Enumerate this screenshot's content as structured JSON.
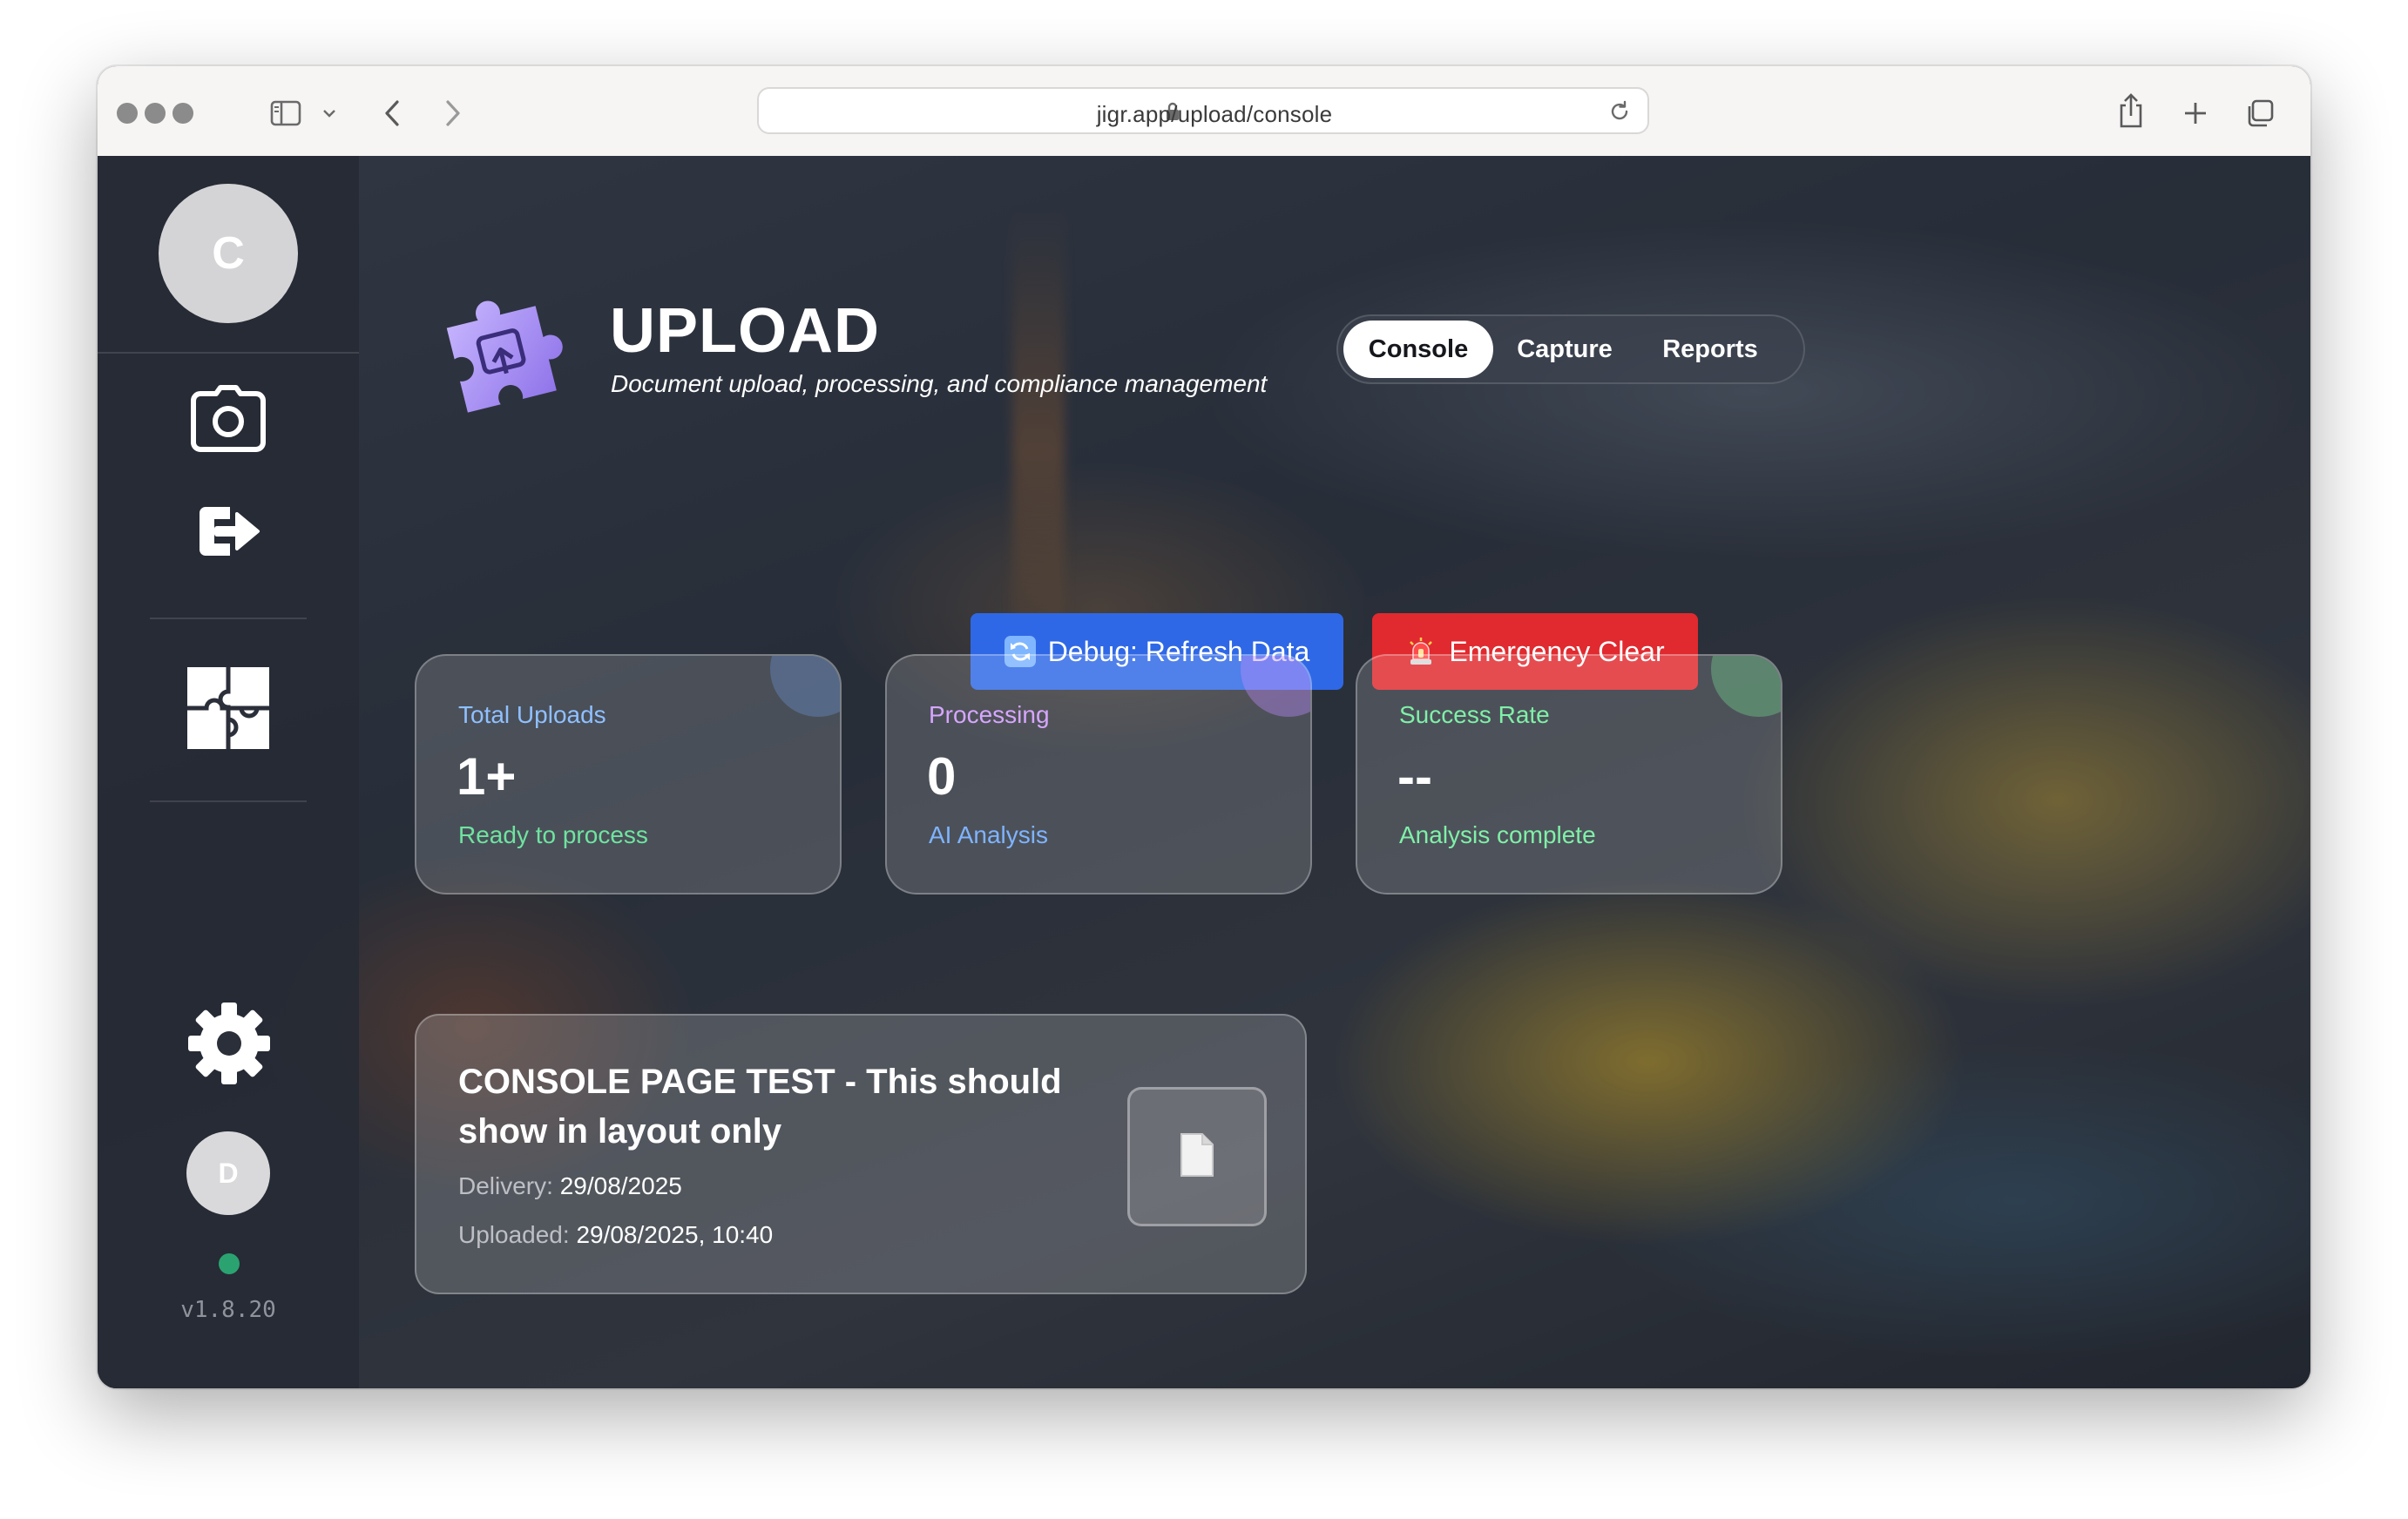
{
  "browser": {
    "url": "jigr.app/upload/console"
  },
  "sidebar": {
    "avatar_top": "C",
    "avatar_bottom": "D",
    "version": "v1.8.20",
    "icons": [
      "camera-icon",
      "logout-icon",
      "puzzle-icon",
      "gear-icon"
    ]
  },
  "header": {
    "title": "UPLOAD",
    "subtitle": "Document upload, processing, and compliance management"
  },
  "tabs": [
    {
      "label": "Console",
      "active": true
    },
    {
      "label": "Capture",
      "active": false
    },
    {
      "label": "Reports",
      "active": false
    }
  ],
  "actions": {
    "refresh_label": "Debug: Refresh Data",
    "clear_label": "Emergency Clear"
  },
  "stats": [
    {
      "label": "Total Uploads",
      "value": "1+",
      "sub": "Ready to process",
      "label_color": "#8fc0ff",
      "sub_color": "#6fe3a0"
    },
    {
      "label": "Processing",
      "value": "0",
      "sub": "AI Analysis",
      "label_color": "#d6a6ff",
      "sub_color": "#7fb4ff"
    },
    {
      "label": "Success Rate",
      "value": "--",
      "sub": "Analysis complete",
      "label_color": "#7ff0a8",
      "sub_color": "#7ff0a8"
    }
  ],
  "document": {
    "title": "CONSOLE PAGE TEST - This should show in layout only",
    "delivery_label": "Delivery:",
    "delivery_value": "29/08/2025",
    "uploaded_label": "Uploaded:",
    "uploaded_value": "29/08/2025, 10:40"
  },
  "colors": {
    "accent_blue": "#2f68e6",
    "danger_red": "#e02a2f",
    "status_green": "#2aa371"
  }
}
